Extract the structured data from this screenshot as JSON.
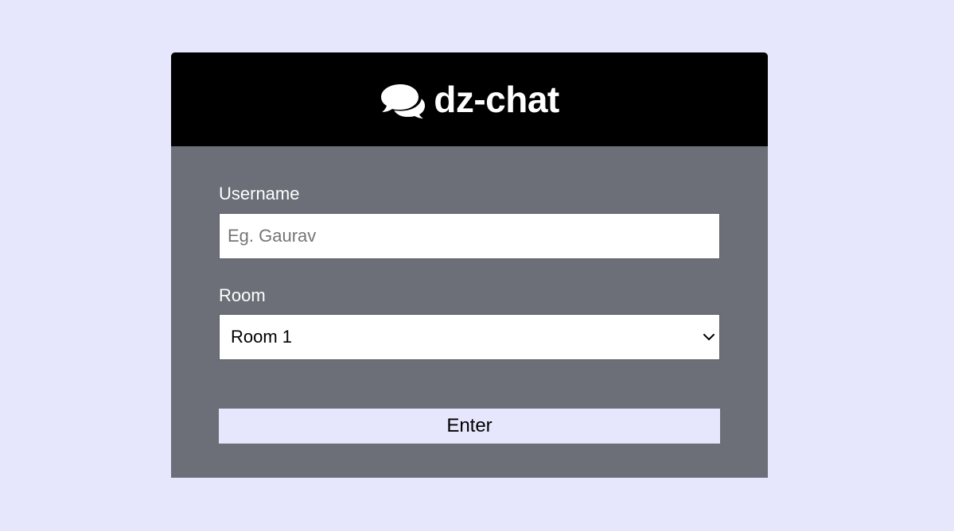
{
  "header": {
    "logo_icon": "comments-icon",
    "title": "dz-chat"
  },
  "form": {
    "username": {
      "label": "Username",
      "value": "",
      "placeholder": "Eg. Gaurav"
    },
    "room": {
      "label": "Room",
      "selected": "Room 1",
      "icon": "chevron-down-icon"
    },
    "submit_label": "Enter"
  },
  "colors": {
    "page_background": "#e6e6fd",
    "header_background": "#000000",
    "card_background": "#6c6f78",
    "button_background": "#e6e6fd",
    "text_light": "#ffffff"
  }
}
